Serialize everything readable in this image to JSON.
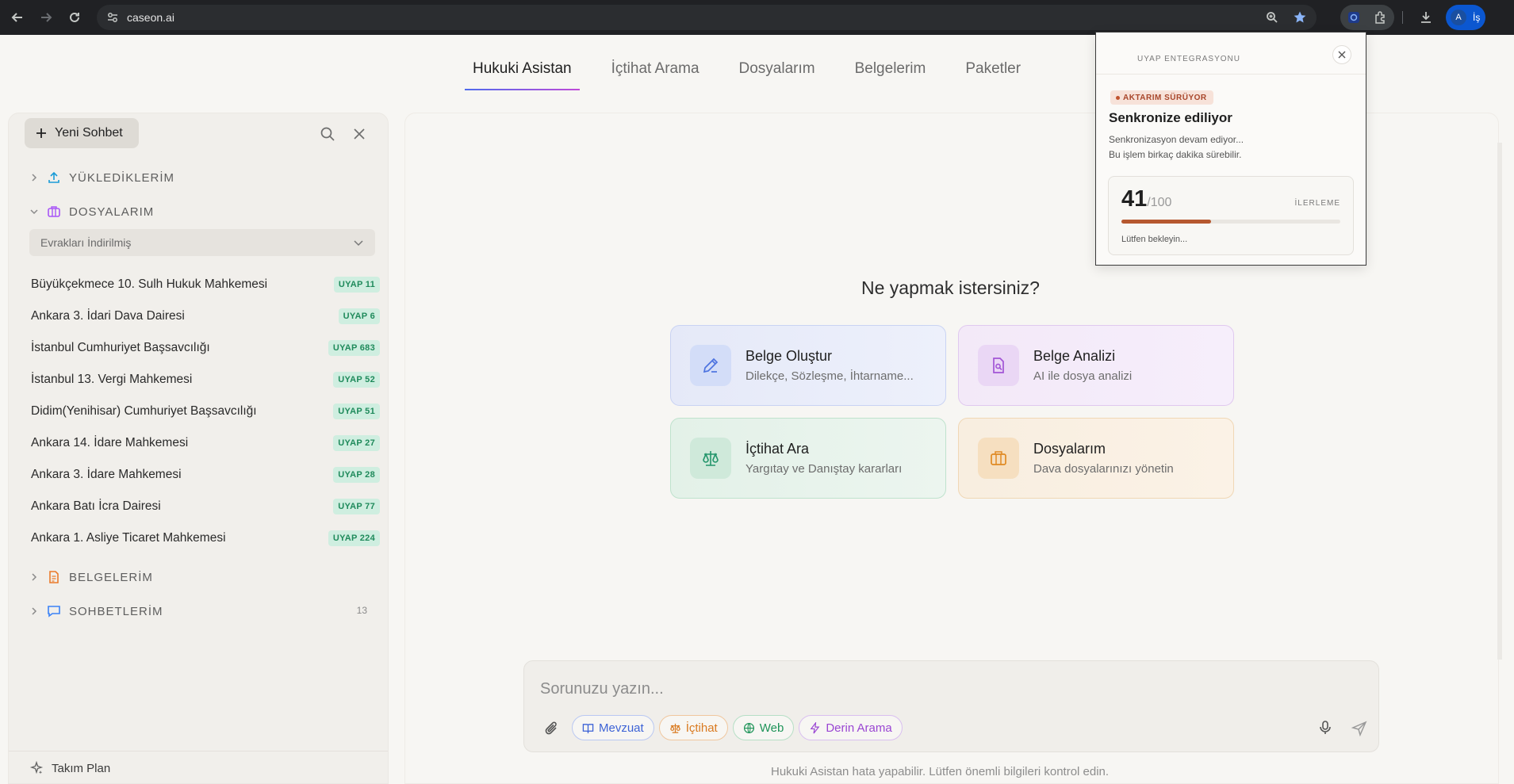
{
  "browser": {
    "url": "caseon.ai",
    "profile_initial": "A",
    "profile_label": "İş"
  },
  "nav": {
    "tabs": [
      {
        "label": "Hukuki Asistan",
        "active": true
      },
      {
        "label": "İçtihat Arama"
      },
      {
        "label": "Dosyalarım"
      },
      {
        "label": "Belgelerim"
      },
      {
        "label": "Paketler"
      }
    ]
  },
  "sidebar": {
    "new_chat": "Yeni Sohbet",
    "sections": {
      "uploads": "YÜKLEDİKLERİM",
      "cases": "DOSYALARIM",
      "documents": "BELGELERİM",
      "chats": "SOHBETLERİM",
      "chats_count": "13"
    },
    "filter": "Evrakları İndirilmiş",
    "cases": [
      {
        "name": "Büyükçekmece 10. Sulh Hukuk Mahkemesi",
        "badge": "UYAP 11"
      },
      {
        "name": "Ankara 3. İdari Dava Dairesi",
        "badge": "UYAP 6"
      },
      {
        "name": "İstanbul Cumhuriyet Başsavcılığı",
        "badge": "UYAP 683"
      },
      {
        "name": "İstanbul 13. Vergi Mahkemesi",
        "badge": "UYAP 52"
      },
      {
        "name": "Didim(Yenihisar) Cumhuriyet Başsavcılığı",
        "badge": "UYAP 51"
      },
      {
        "name": "Ankara 14. İdare Mahkemesi",
        "badge": "UYAP 27"
      },
      {
        "name": "Ankara 3. İdare Mahkemesi",
        "badge": "UYAP 28"
      },
      {
        "name": "Ankara Batı İcra Dairesi",
        "badge": "UYAP 77"
      },
      {
        "name": "Ankara 1. Asliye Ticaret Mahkemesi",
        "badge": "UYAP 224"
      }
    ],
    "footer": "Takım Plan"
  },
  "main": {
    "question": "Ne yapmak istersiniz?",
    "cards": [
      {
        "title": "Belge Oluştur",
        "desc": "Dilekçe, Sözleşme, İhtarname..."
      },
      {
        "title": "Belge Analizi",
        "desc": "AI ile dosya analizi"
      },
      {
        "title": "İçtihat Ara",
        "desc": "Yargıtay ve Danıştay kararları"
      },
      {
        "title": "Dosyalarım",
        "desc": "Dava dosyalarınızı yönetin"
      }
    ],
    "composer": {
      "placeholder": "Sorunuzu yazın...",
      "chips": [
        "Mevzuat",
        "İçtihat",
        "Web",
        "Derin Arama"
      ]
    },
    "disclaimer": "Hukuki Asistan hata yapabilir. Lütfen önemli bilgileri kontrol edin."
  },
  "popup": {
    "header": "UYAP ENTEGRASYONU",
    "status": "AKTARIM SÜRÜYOR",
    "title": "Senkronize ediliyor",
    "desc_line1": "Senkronizasyon devam ediyor...",
    "desc_line2": "Bu işlem birkaç dakika sürebilir.",
    "progress_value": "41",
    "progress_total": "/100",
    "progress_label": "İLERLEME",
    "progress_fraction": 0.41,
    "wait_text": "Lütfen bekleyin..."
  },
  "colors": {
    "accent_gradient_start": "#4f6bed",
    "accent_gradient_end": "#c04bd8",
    "badge_bg": "#cfeee0",
    "badge_text": "#1f8a5b",
    "progress_fill": "#b6582f"
  }
}
